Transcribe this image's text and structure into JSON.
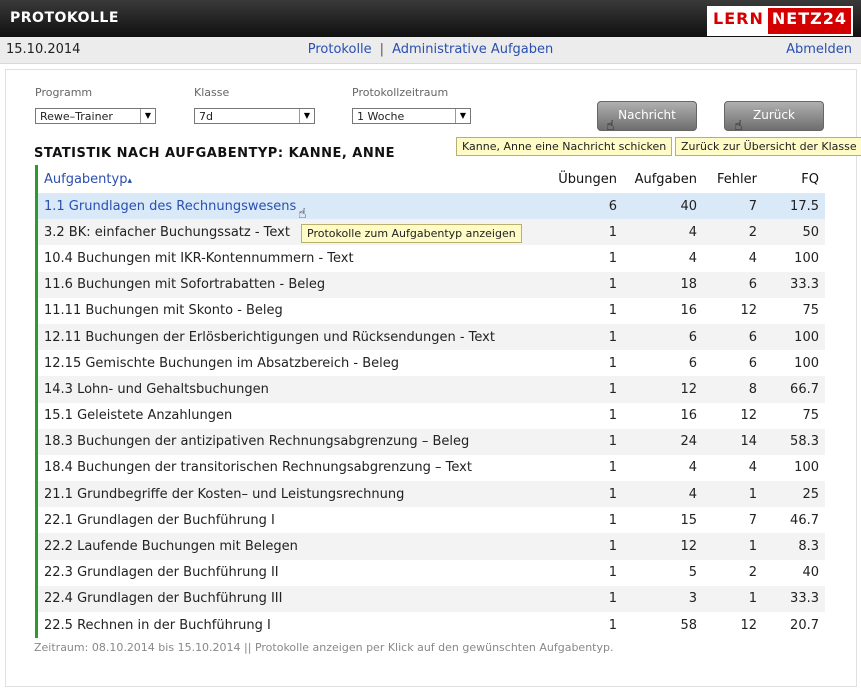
{
  "header": {
    "title": "PROTOKOLLE",
    "logo_left": "LERN",
    "logo_right": "NETZ24"
  },
  "subbar": {
    "date": "15.10.2014",
    "nav_protokolle": "Protokolle",
    "nav_separator": "|",
    "nav_admin": "Administrative Aufgaben",
    "logout": "Abmelden"
  },
  "filters": {
    "programm_label": "Programm",
    "programm_value": "Rewe–Trainer",
    "klasse_label": "Klasse",
    "klasse_value": "7d",
    "zeitraum_label": "Protokollzeitraum",
    "zeitraum_value": "1 Woche"
  },
  "buttons": {
    "nachricht": "Nachricht",
    "zurueck": "Zurück"
  },
  "tooltips": {
    "nachricht": "Kanne, Anne eine Nachricht schicken",
    "zurueck": "Zurück zur Übersicht der Klasse",
    "row": "Protokolle zum Aufgabentyp anzeigen"
  },
  "section_title": "STATISTIK NACH AUFGABENTYP: KANNE, ANNE",
  "table": {
    "headers": {
      "name": "Aufgabentyp",
      "sort_indicator": "▴",
      "uebungen": "Übungen",
      "aufgaben": "Aufgaben",
      "fehler": "Fehler",
      "fq": "FQ"
    },
    "rows": [
      {
        "name": "1.1 Grundlagen des Rechnungswesens",
        "uebungen": "6",
        "aufgaben": "40",
        "fehler": "7",
        "fq": "17.5"
      },
      {
        "name": "3.2 BK: einfacher Buchungssatz - Text",
        "uebungen": "1",
        "aufgaben": "4",
        "fehler": "2",
        "fq": "50"
      },
      {
        "name": "10.4 Buchungen mit IKR-Kontennummern - Text",
        "uebungen": "1",
        "aufgaben": "4",
        "fehler": "4",
        "fq": "100"
      },
      {
        "name": "11.6 Buchungen mit Sofortrabatten - Beleg",
        "uebungen": "1",
        "aufgaben": "18",
        "fehler": "6",
        "fq": "33.3"
      },
      {
        "name": "11.11 Buchungen mit Skonto - Beleg",
        "uebungen": "1",
        "aufgaben": "16",
        "fehler": "12",
        "fq": "75"
      },
      {
        "name": "12.11 Buchungen der Erlösberichtigungen und Rücksendungen - Text",
        "uebungen": "1",
        "aufgaben": "6",
        "fehler": "6",
        "fq": "100"
      },
      {
        "name": "12.15 Gemischte Buchungen im Absatzbereich - Beleg",
        "uebungen": "1",
        "aufgaben": "6",
        "fehler": "6",
        "fq": "100"
      },
      {
        "name": "14.3 Lohn- und Gehaltsbuchungen",
        "uebungen": "1",
        "aufgaben": "12",
        "fehler": "8",
        "fq": "66.7"
      },
      {
        "name": "15.1 Geleistete Anzahlungen",
        "uebungen": "1",
        "aufgaben": "16",
        "fehler": "12",
        "fq": "75"
      },
      {
        "name": "18.3 Buchungen der antizipativen Rechnungsabgrenzung – Beleg",
        "uebungen": "1",
        "aufgaben": "24",
        "fehler": "14",
        "fq": "58.3"
      },
      {
        "name": "18.4 Buchungen der transitorischen Rechnungsabgrenzung – Text",
        "uebungen": "1",
        "aufgaben": "4",
        "fehler": "4",
        "fq": "100"
      },
      {
        "name": "21.1 Grundbegriffe der Kosten– und Leistungsrechnung",
        "uebungen": "1",
        "aufgaben": "4",
        "fehler": "1",
        "fq": "25"
      },
      {
        "name": "22.1 Grundlagen der Buchführung I",
        "uebungen": "1",
        "aufgaben": "15",
        "fehler": "7",
        "fq": "46.7"
      },
      {
        "name": "22.2 Laufende Buchungen mit Belegen",
        "uebungen": "1",
        "aufgaben": "12",
        "fehler": "1",
        "fq": "8.3"
      },
      {
        "name": "22.3 Grundlagen der Buchführung II",
        "uebungen": "1",
        "aufgaben": "5",
        "fehler": "2",
        "fq": "40"
      },
      {
        "name": "22.4 Grundlagen der Buchführung III",
        "uebungen": "1",
        "aufgaben": "3",
        "fehler": "1",
        "fq": "33.3"
      },
      {
        "name": "22.5 Rechnen in der Buchführung I",
        "uebungen": "1",
        "aufgaben": "58",
        "fehler": "12",
        "fq": "20.7"
      }
    ]
  },
  "footer": "Zeitraum: 08.10.2014 bis 15.10.2014 || Protokolle anzeigen per Klick auf den gewünschten Aufgabentyp.",
  "icons": {
    "cursor": "hand-cursor-icon",
    "dropdown": "chevron-down-icon"
  },
  "colors": {
    "accent_green": "#2e9a2e",
    "link_blue": "#2b4fb0",
    "highlight_row": "#d9e9f8",
    "logo_red": "#d40000"
  }
}
